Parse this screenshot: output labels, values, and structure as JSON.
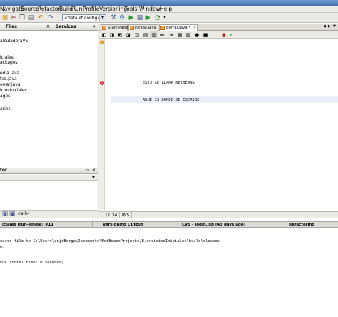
{
  "menu": [
    "Navigate",
    "Source",
    "Refactor",
    "Build",
    "Run",
    "Profile",
    "Versioning",
    "Tools",
    "Window",
    "Help"
  ],
  "toolbar": {
    "config_value": "<default config>"
  },
  "left_panel": {
    "tab_files": "Files",
    "tab_services": "Services",
    "tree": [
      "alculadoraVS",
      "iciales",
      "ackages",
      "edia.java",
      "tas.java",
      "orrar.java",
      "iciosIniciales",
      "ages",
      "aries"
    ]
  },
  "navigator": {
    "title": "tor",
    "footer_text": "<all>"
  },
  "editor": {
    "tabs": [
      "Start Page",
      "Notas.java",
      "borrar.java *"
    ],
    "lines": [
      "ESTO SE LLAMA NETBEANS",
      "AQUI ES DONDE SE ESCRIBE"
    ],
    "status": {
      "position": "11:34",
      "mode": "INS"
    }
  },
  "bottom": {
    "tabs": [
      "iciales (run-single) #11",
      "Versioning Output",
      "CVS - login.jsp (43 days ago)",
      "Refactoring"
    ],
    "output": [
      "ource file to C:\\Users\\anjeBorga\\Documents\\NetBeansProjects\\EjerciciosIniciales\\build\\classes",
      "e:",
      "",
      "FUL (total time: 0 seconds)"
    ]
  }
}
